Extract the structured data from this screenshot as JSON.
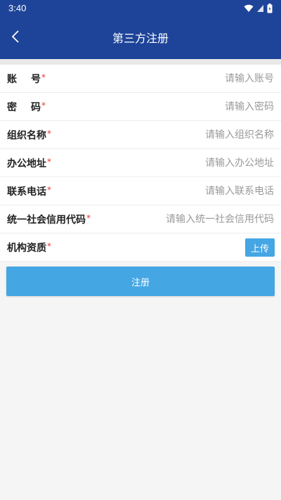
{
  "status_bar": {
    "time": "3:40"
  },
  "header": {
    "title": "第三方注册"
  },
  "form": {
    "account": {
      "label": "账号",
      "required_mark": "*",
      "placeholder": "请输入账号"
    },
    "password": {
      "label": "密码",
      "required_mark": "*",
      "placeholder": "请输入密码"
    },
    "org_name": {
      "label": "组织名称",
      "required_mark": "*",
      "placeholder": "请输入组织名称"
    },
    "address": {
      "label": "办公地址",
      "required_mark": "*",
      "placeholder": "请输入办公地址"
    },
    "phone": {
      "label": "联系电话",
      "required_mark": "*",
      "placeholder": "请输入联系电话"
    },
    "credit_code": {
      "label": "统一社会信用代码",
      "required_mark": "*",
      "placeholder": "请输入统一社会信用代码"
    },
    "qualification": {
      "label": "机构资质",
      "required_mark": "*",
      "upload_label": "上传"
    }
  },
  "actions": {
    "register_label": "注册"
  },
  "colors": {
    "header_bg": "#1e4499",
    "accent": "#45a6e4",
    "required": "#e53935"
  },
  "icons": {
    "back": "chevron-left-icon",
    "wifi": "wifi-icon",
    "signal": "signal-icon",
    "battery": "battery-icon"
  }
}
